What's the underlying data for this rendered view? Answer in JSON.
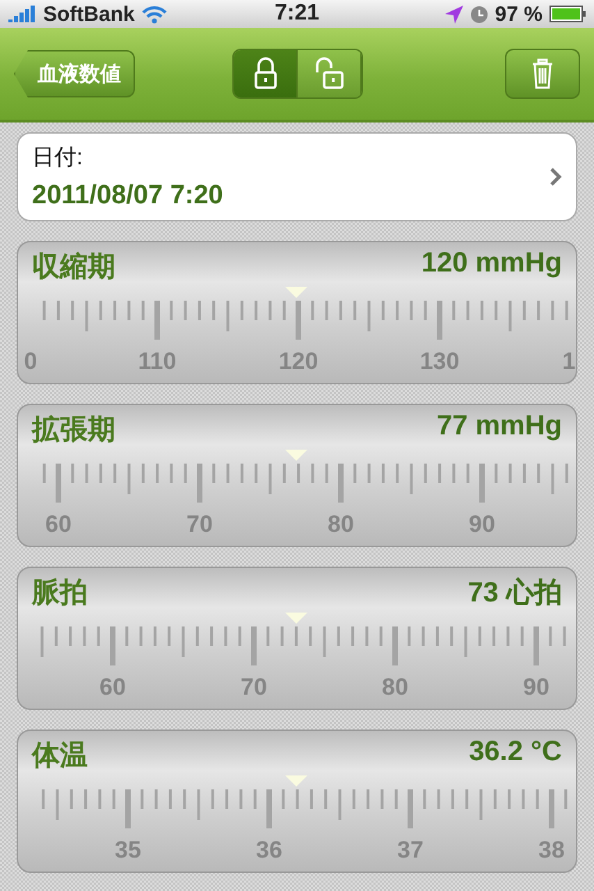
{
  "status_bar": {
    "carrier": "SoftBank",
    "time": "7:21",
    "battery": "97 %"
  },
  "nav_bar": {
    "back": "血液数値",
    "lock_segments": [
      {
        "kind": "locked",
        "selected": true
      },
      {
        "kind": "unlocked",
        "selected": false
      }
    ]
  },
  "date": {
    "label": "日付:",
    "value": "2011/08/07 7:20"
  },
  "measures": [
    {
      "name": "収縮期",
      "reading": "120 mmHg",
      "level": 0.5,
      "scale": [
        "0",
        "110",
        "120",
        "130",
        "1"
      ]
    },
    {
      "name": "拡張期",
      "reading": "77 mmHg",
      "level": 0.5,
      "scale": [
        "60",
        "70",
        "80",
        "90"
      ]
    },
    {
      "name": "脈拍",
      "reading": "73 心拍",
      "level": 0.5,
      "scale": [
        "60",
        "70",
        "80",
        "90"
      ]
    },
    {
      "name": "体温",
      "reading": "36.2 °C",
      "level": 0.5,
      "scale": [
        "35",
        "36",
        "37",
        "38"
      ]
    }
  ]
}
